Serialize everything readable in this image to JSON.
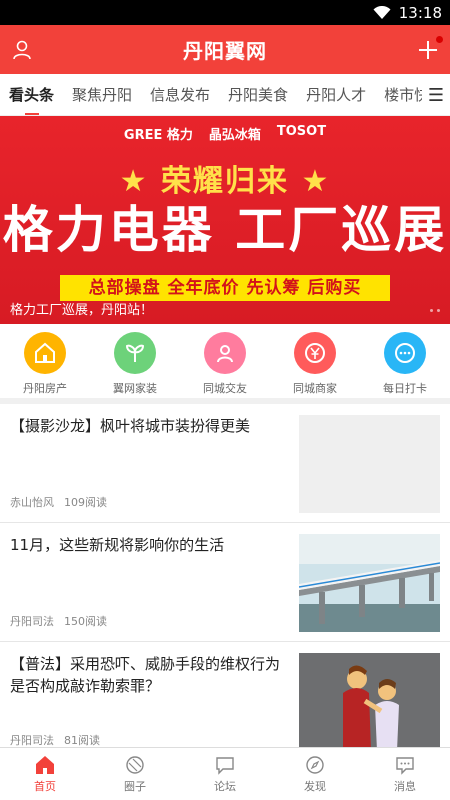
{
  "status": {
    "time": "13:18"
  },
  "header": {
    "title": "丹阳翼网",
    "user_icon": "user-icon",
    "add_icon": "plus-icon"
  },
  "tabs": [
    {
      "label": "看头条"
    },
    {
      "label": "聚焦丹阳"
    },
    {
      "label": "信息发布"
    },
    {
      "label": "丹阳美食"
    },
    {
      "label": "丹阳人才"
    },
    {
      "label": "楼市快"
    }
  ],
  "banner": {
    "brands": [
      "GREE 格力",
      "晶弘冰箱",
      "TOSOT"
    ],
    "line1": "★ 荣耀归来 ★",
    "line2": "格力电器 工厂巡展",
    "line3": "总部操盘 全年底价 先认筹 后购买",
    "caption": "格力工厂巡展，丹阳站！"
  },
  "quick": [
    {
      "label": "丹阳房产",
      "color": "#ffb400",
      "icon": "house-icon"
    },
    {
      "label": "翼网家装",
      "color": "#6dd27a",
      "icon": "sprout-icon"
    },
    {
      "label": "同城交友",
      "color": "#ff7c9e",
      "icon": "heart-person-icon"
    },
    {
      "label": "同城商家",
      "color": "#ff5b5b",
      "icon": "yen-icon"
    },
    {
      "label": "每日打卡",
      "color": "#29b6f6",
      "icon": "chat-icon"
    }
  ],
  "news": [
    {
      "title": "【摄影沙龙】枫叶将城市装扮得更美",
      "source": "赤山怡风",
      "reads": "109阅读",
      "thumb": "blank"
    },
    {
      "title": "11月，这些新规将影响你的生活",
      "source": "丹阳司法",
      "reads": "150阅读",
      "thumb": "train"
    },
    {
      "title": "【普法】采用恐吓、威胁手段的维权行为是否构成敲诈勒索罪？",
      "source": "丹阳司法",
      "reads": "81阅读",
      "thumb": "people"
    }
  ],
  "bottom_nav": [
    {
      "label": "首页",
      "icon": "home-icon",
      "active": true
    },
    {
      "label": "圈子",
      "icon": "circle-icon",
      "active": false
    },
    {
      "label": "论坛",
      "icon": "forum-icon",
      "active": false
    },
    {
      "label": "发现",
      "icon": "compass-icon",
      "active": false
    },
    {
      "label": "消息",
      "icon": "message-icon",
      "active": false
    }
  ],
  "colors": {
    "accent": "#f2413a"
  }
}
